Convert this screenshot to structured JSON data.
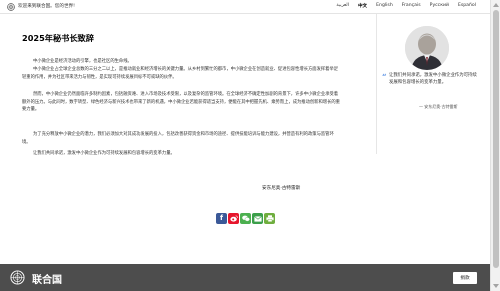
{
  "topbar": {
    "welcome": "欢迎来到联合国。您的世界!",
    "languages": [
      "العربية",
      "中文",
      "English",
      "Français",
      "Русский",
      "Español"
    ],
    "active_language": "中文"
  },
  "article": {
    "title": "2025年秘书长致辞",
    "paragraphs": [
      "中小微企业是经济活动的引擎，也是社区的生命线。",
      "中小微企业占全球企业总数的三分之二以上，是推动就业和经济增长的关键力量。从乡村到繁忙的都市，中小微企业在创造就业、促进包容性增长方面发挥着举足轻重的作用，并为社区带来活力与韧性，是实现可持续发展目标不可或缺的伙伴。",
      "然而，中小微企业仍然面临许多制约因素，包括融资难、进入市场及技术受限，以及复杂的监管环境。在全球经济不确定性加剧的背景下，许多中小微企业承受着额外的压力。与此同时，数字转型、绿色经济与新兴技术也带来了新的机遇，中小微企业若能获得适当支持，便能在其中把握先机、乘势而上，成为推动创新和增长的重要力量。",
      "为了充分释放中小微企业的潜力，我们必须加大对其成功发展的投入，包括改善获得资金和市场的途径、提供技能培训与能力建设，并营造有利的政策与监管环境。",
      "让我们共同承诺，激发中小微企业作为可持续发展和包容增长的变革力量。"
    ],
    "signature": "安东尼奥·古特雷斯"
  },
  "sidebar": {
    "quote": "让我们共同承诺，激发中小微企业作为可持续发展和包容增长的变革力量。",
    "author": "— 安东尼奥·古特雷斯"
  },
  "share": {
    "buttons": [
      {
        "name": "facebook-icon",
        "glyph": "f",
        "color": "#3b5998"
      },
      {
        "name": "weibo-icon",
        "glyph": "微",
        "color": "#e6162d"
      },
      {
        "name": "wechat-icon",
        "glyph": "✆",
        "color": "#4cb050"
      },
      {
        "name": "email-icon",
        "glyph": "✉",
        "color": "#3b9f4a"
      },
      {
        "name": "print-icon",
        "glyph": "⎙",
        "color": "#6fae3e"
      }
    ]
  },
  "footer": {
    "org_name": "联合国",
    "donate": "捐款"
  },
  "colors": {
    "footer_bg": "#4d4d4d",
    "accent": "#5b92e5"
  }
}
